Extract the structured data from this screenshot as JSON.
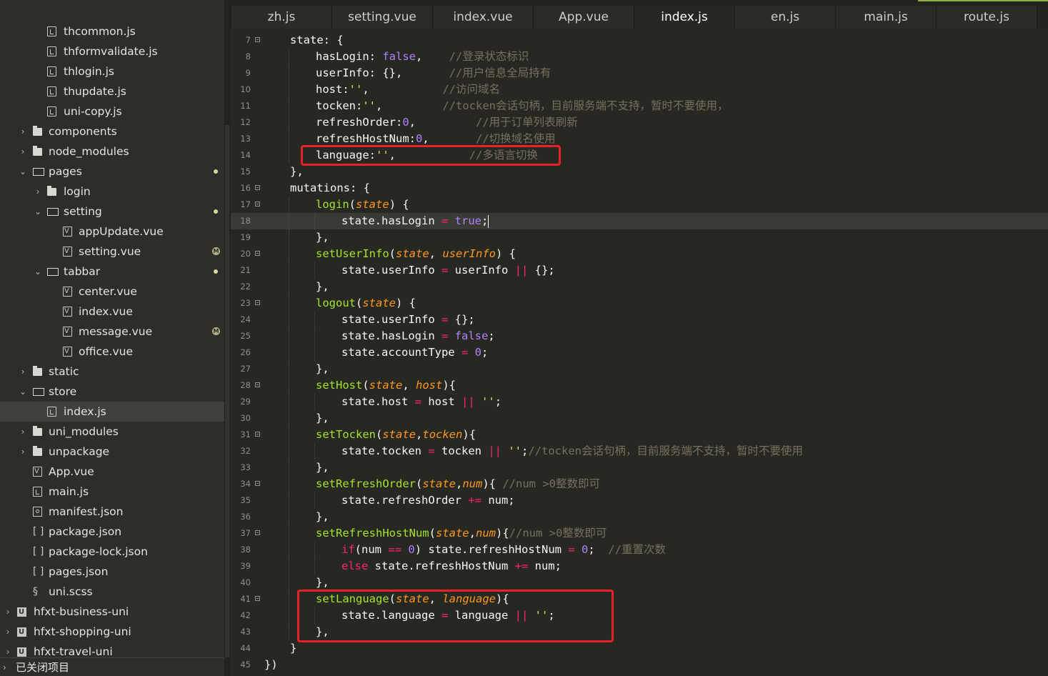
{
  "sidebar": {
    "items": [
      {
        "label": "thcommon.js",
        "icon": "js-file-icon",
        "depth": 2,
        "type": "file"
      },
      {
        "label": "thformvalidate.js",
        "icon": "js-file-icon",
        "depth": 2,
        "type": "file"
      },
      {
        "label": "thlogin.js",
        "icon": "js-file-icon",
        "depth": 2,
        "type": "file"
      },
      {
        "label": "thupdate.js",
        "icon": "js-file-icon",
        "depth": 2,
        "type": "file"
      },
      {
        "label": "uni-copy.js",
        "icon": "js-file-icon",
        "depth": 2,
        "type": "file"
      },
      {
        "label": "components",
        "icon": "folder-icon",
        "depth": 1,
        "type": "folder",
        "arrow": "›"
      },
      {
        "label": "node_modules",
        "icon": "folder-icon",
        "depth": 1,
        "type": "folder",
        "arrow": "›"
      },
      {
        "label": "pages",
        "icon": "folder-open-icon",
        "depth": 1,
        "type": "folder-open",
        "arrow": "⌄",
        "dot": true
      },
      {
        "label": "login",
        "icon": "folder-icon",
        "depth": 2,
        "type": "folder",
        "arrow": "›"
      },
      {
        "label": "setting",
        "icon": "folder-open-icon",
        "depth": 2,
        "type": "folder-open",
        "arrow": "⌄",
        "dot": true
      },
      {
        "label": "appUpdate.vue",
        "icon": "vue-file-icon",
        "depth": 3,
        "type": "vue"
      },
      {
        "label": "setting.vue",
        "icon": "vue-file-icon",
        "depth": 3,
        "type": "vue",
        "badge": "M",
        "modified": true
      },
      {
        "label": "tabbar",
        "icon": "folder-open-icon",
        "depth": 2,
        "type": "folder-open",
        "arrow": "⌄",
        "dot": true
      },
      {
        "label": "center.vue",
        "icon": "vue-file-icon",
        "depth": 3,
        "type": "vue"
      },
      {
        "label": "index.vue",
        "icon": "vue-file-icon",
        "depth": 3,
        "type": "vue"
      },
      {
        "label": "message.vue",
        "icon": "vue-file-icon",
        "depth": 3,
        "type": "vue",
        "badge": "M",
        "modified": true
      },
      {
        "label": "office.vue",
        "icon": "vue-file-icon",
        "depth": 3,
        "type": "vue"
      },
      {
        "label": "static",
        "icon": "folder-icon",
        "depth": 1,
        "type": "folder",
        "arrow": "›"
      },
      {
        "label": "store",
        "icon": "folder-open-icon",
        "depth": 1,
        "type": "folder-open",
        "arrow": "⌄"
      },
      {
        "label": "index.js",
        "icon": "js-file-icon",
        "depth": 2,
        "type": "file",
        "selected": true
      },
      {
        "label": "uni_modules",
        "icon": "folder-icon",
        "depth": 1,
        "type": "folder",
        "arrow": "›"
      },
      {
        "label": "unpackage",
        "icon": "folder-icon",
        "depth": 1,
        "type": "folder",
        "arrow": "›"
      },
      {
        "label": "App.vue",
        "icon": "vue-file-icon",
        "depth": 1,
        "type": "vue"
      },
      {
        "label": "main.js",
        "icon": "js-file-icon",
        "depth": 1,
        "type": "file"
      },
      {
        "label": "manifest.json",
        "icon": "gear-file-icon",
        "depth": 1,
        "type": "gear"
      },
      {
        "label": "package.json",
        "icon": "brackets-icon",
        "depth": 1,
        "type": "brackets",
        "glyph": "[ ]"
      },
      {
        "label": "package-lock.json",
        "icon": "brackets-icon",
        "depth": 1,
        "type": "brackets",
        "glyph": "[ ]"
      },
      {
        "label": "pages.json",
        "icon": "brackets-icon",
        "depth": 1,
        "type": "brackets",
        "glyph": "[ ]"
      },
      {
        "label": "uni.scss",
        "icon": "scss-icon",
        "depth": 1,
        "type": "scss",
        "glyph": "§"
      },
      {
        "label": "hfxt-business-uni",
        "icon": "project-icon",
        "depth": 0,
        "type": "project",
        "arrow": "›"
      },
      {
        "label": "hfxt-shopping-uni",
        "icon": "project-icon",
        "depth": 0,
        "type": "project",
        "arrow": "›"
      },
      {
        "label": "hfxt-travel-uni",
        "icon": "project-icon",
        "depth": 0,
        "type": "project",
        "arrow": "›"
      }
    ],
    "closed_projects": "已关闭项目"
  },
  "tabs": [
    "zh.js",
    "setting.vue",
    "index.vue",
    "App.vue",
    "index.js",
    "en.js",
    "main.js",
    "route.js"
  ],
  "active_tab": 4,
  "editor": {
    "cursor_line": 18,
    "lines": [
      {
        "n": 7,
        "fold": true,
        "indent": 1,
        "t": [
          [
            "p",
            "state: {"
          ]
        ]
      },
      {
        "n": 8,
        "indent": 2,
        "t": [
          [
            "p",
            "hasLogin: "
          ],
          [
            "b",
            "false"
          ],
          [
            "p",
            ",    "
          ],
          [
            "c",
            "//登录状态标识"
          ]
        ]
      },
      {
        "n": 9,
        "indent": 2,
        "t": [
          [
            "p",
            "userInfo: {},       "
          ],
          [
            "c",
            "//用户信息全局持有"
          ]
        ]
      },
      {
        "n": 10,
        "indent": 2,
        "t": [
          [
            "p",
            "host:"
          ],
          [
            "s",
            "''"
          ],
          [
            "p",
            ",           "
          ],
          [
            "c",
            "//访问域名"
          ]
        ]
      },
      {
        "n": 11,
        "indent": 2,
        "t": [
          [
            "p",
            "tocken:"
          ],
          [
            "s",
            "''"
          ],
          [
            "p",
            ",         "
          ],
          [
            "c",
            "//tocken会话句柄，目前服务端不支持，暂时不要使用，"
          ]
        ]
      },
      {
        "n": 12,
        "indent": 2,
        "t": [
          [
            "p",
            "refreshOrder:"
          ],
          [
            "b",
            "0"
          ],
          [
            "p",
            ",         "
          ],
          [
            "c",
            "//用于订单列表刷新"
          ]
        ]
      },
      {
        "n": 13,
        "indent": 2,
        "t": [
          [
            "p",
            "refreshHostNum:"
          ],
          [
            "b",
            "0"
          ],
          [
            "p",
            ",       "
          ],
          [
            "c",
            "//切换域名使用"
          ]
        ]
      },
      {
        "n": 14,
        "indent": 2,
        "t": [
          [
            "p",
            "language:"
          ],
          [
            "s",
            "''"
          ],
          [
            "p",
            ",           "
          ],
          [
            "c",
            "//多语言切换"
          ]
        ]
      },
      {
        "n": 15,
        "indent": 1,
        "t": [
          [
            "p",
            "},"
          ]
        ]
      },
      {
        "n": 16,
        "fold": true,
        "indent": 1,
        "t": [
          [
            "p",
            "mutations: {"
          ]
        ]
      },
      {
        "n": 17,
        "fold": true,
        "indent": 2,
        "t": [
          [
            "f",
            "login"
          ],
          [
            "p",
            "("
          ],
          [
            "a",
            "state"
          ],
          [
            "p",
            ") {"
          ]
        ]
      },
      {
        "n": 18,
        "indent": 3,
        "t": [
          [
            "p",
            "state.hasLogin "
          ],
          [
            "o",
            "="
          ],
          [
            "p",
            " "
          ],
          [
            "b",
            "true"
          ],
          [
            "p",
            ";"
          ]
        ]
      },
      {
        "n": 19,
        "indent": 2,
        "t": [
          [
            "p",
            "},"
          ]
        ]
      },
      {
        "n": 20,
        "fold": true,
        "indent": 2,
        "t": [
          [
            "f",
            "setUserInfo"
          ],
          [
            "p",
            "("
          ],
          [
            "a",
            "state"
          ],
          [
            "p",
            ", "
          ],
          [
            "a",
            "userInfo"
          ],
          [
            "p",
            ") {"
          ]
        ]
      },
      {
        "n": 21,
        "indent": 3,
        "t": [
          [
            "p",
            "state.userInfo "
          ],
          [
            "o",
            "="
          ],
          [
            "p",
            " userInfo "
          ],
          [
            "o",
            "||"
          ],
          [
            "p",
            " {};"
          ]
        ]
      },
      {
        "n": 22,
        "indent": 2,
        "t": [
          [
            "p",
            "},"
          ]
        ]
      },
      {
        "n": 23,
        "fold": true,
        "indent": 2,
        "t": [
          [
            "f",
            "logout"
          ],
          [
            "p",
            "("
          ],
          [
            "a",
            "state"
          ],
          [
            "p",
            ") {"
          ]
        ]
      },
      {
        "n": 24,
        "indent": 3,
        "t": [
          [
            "p",
            "state.userInfo "
          ],
          [
            "o",
            "="
          ],
          [
            "p",
            " {};"
          ]
        ]
      },
      {
        "n": 25,
        "indent": 3,
        "t": [
          [
            "p",
            "state.hasLogin "
          ],
          [
            "o",
            "="
          ],
          [
            "p",
            " "
          ],
          [
            "b",
            "false"
          ],
          [
            "p",
            ";"
          ]
        ]
      },
      {
        "n": 26,
        "indent": 3,
        "t": [
          [
            "p",
            "state.accountType "
          ],
          [
            "o",
            "="
          ],
          [
            "p",
            " "
          ],
          [
            "b",
            "0"
          ],
          [
            "p",
            ";"
          ]
        ]
      },
      {
        "n": 27,
        "indent": 2,
        "t": [
          [
            "p",
            "},"
          ]
        ]
      },
      {
        "n": 28,
        "fold": true,
        "indent": 2,
        "t": [
          [
            "f",
            "setHost"
          ],
          [
            "p",
            "("
          ],
          [
            "a",
            "state"
          ],
          [
            "p",
            ", "
          ],
          [
            "a",
            "host"
          ],
          [
            "p",
            "){"
          ]
        ]
      },
      {
        "n": 29,
        "indent": 3,
        "t": [
          [
            "p",
            "state.host "
          ],
          [
            "o",
            "="
          ],
          [
            "p",
            " host "
          ],
          [
            "o",
            "||"
          ],
          [
            "p",
            " "
          ],
          [
            "s",
            "''"
          ],
          [
            "p",
            ";"
          ]
        ]
      },
      {
        "n": 30,
        "indent": 2,
        "t": [
          [
            "p",
            "},"
          ]
        ]
      },
      {
        "n": 31,
        "fold": true,
        "indent": 2,
        "t": [
          [
            "f",
            "setTocken"
          ],
          [
            "p",
            "("
          ],
          [
            "a",
            "state"
          ],
          [
            "p",
            ","
          ],
          [
            "a",
            "tocken"
          ],
          [
            "p",
            "){"
          ]
        ]
      },
      {
        "n": 32,
        "indent": 3,
        "t": [
          [
            "p",
            "state.tocken "
          ],
          [
            "o",
            "="
          ],
          [
            "p",
            " tocken "
          ],
          [
            "o",
            "||"
          ],
          [
            "p",
            " "
          ],
          [
            "s",
            "''"
          ],
          [
            "p",
            ";"
          ],
          [
            "c",
            "//tocken会话句柄，目前服务端不支持，暂时不要使用"
          ]
        ]
      },
      {
        "n": 33,
        "indent": 2,
        "t": [
          [
            "p",
            "},"
          ]
        ]
      },
      {
        "n": 34,
        "fold": true,
        "indent": 2,
        "t": [
          [
            "f",
            "setRefreshOrder"
          ],
          [
            "p",
            "("
          ],
          [
            "a",
            "state"
          ],
          [
            "p",
            ","
          ],
          [
            "a",
            "num"
          ],
          [
            "p",
            "){ "
          ],
          [
            "c",
            "//num >0整数即可"
          ]
        ]
      },
      {
        "n": 35,
        "indent": 3,
        "t": [
          [
            "p",
            "state.refreshOrder "
          ],
          [
            "o",
            "+="
          ],
          [
            "p",
            " num;"
          ]
        ]
      },
      {
        "n": 36,
        "indent": 2,
        "t": [
          [
            "p",
            "},"
          ]
        ]
      },
      {
        "n": 37,
        "fold": true,
        "indent": 2,
        "t": [
          [
            "f",
            "setRefreshHostNum"
          ],
          [
            "p",
            "("
          ],
          [
            "a",
            "state"
          ],
          [
            "p",
            ","
          ],
          [
            "a",
            "num"
          ],
          [
            "p",
            "){"
          ],
          [
            "c",
            "//num >0整数即可"
          ]
        ]
      },
      {
        "n": 38,
        "indent": 3,
        "t": [
          [
            "k",
            "if"
          ],
          [
            "p",
            "(num "
          ],
          [
            "o",
            "=="
          ],
          [
            "p",
            " "
          ],
          [
            "b",
            "0"
          ],
          [
            "p",
            ") state.refreshHostNum "
          ],
          [
            "o",
            "="
          ],
          [
            "p",
            " "
          ],
          [
            "b",
            "0"
          ],
          [
            "p",
            ";  "
          ],
          [
            "c",
            "//重置次数"
          ]
        ]
      },
      {
        "n": 39,
        "indent": 3,
        "t": [
          [
            "k",
            "else"
          ],
          [
            "p",
            " state.refreshHostNum "
          ],
          [
            "o",
            "+="
          ],
          [
            "p",
            " num;"
          ]
        ]
      },
      {
        "n": 40,
        "indent": 2,
        "t": [
          [
            "p",
            "},"
          ]
        ]
      },
      {
        "n": 41,
        "fold": true,
        "indent": 2,
        "t": [
          [
            "f",
            "setLanguage"
          ],
          [
            "p",
            "("
          ],
          [
            "a",
            "state"
          ],
          [
            "p",
            ", "
          ],
          [
            "a",
            "language"
          ],
          [
            "p",
            "){"
          ]
        ]
      },
      {
        "n": 42,
        "indent": 3,
        "t": [
          [
            "p",
            "state.language "
          ],
          [
            "o",
            "="
          ],
          [
            "p",
            " language "
          ],
          [
            "o",
            "||"
          ],
          [
            "p",
            " "
          ],
          [
            "s",
            "''"
          ],
          [
            "p",
            ";"
          ]
        ]
      },
      {
        "n": 43,
        "indent": 2,
        "t": [
          [
            "p",
            "},"
          ]
        ]
      },
      {
        "n": 44,
        "indent": 1,
        "t": [
          [
            "p",
            "}"
          ]
        ]
      },
      {
        "n": 45,
        "indent": 0,
        "t": [
          [
            "p",
            "})"
          ]
        ]
      }
    ]
  },
  "colors": {
    "highlight_box": "#e8212a",
    "tab_accent": "#8fb446"
  }
}
